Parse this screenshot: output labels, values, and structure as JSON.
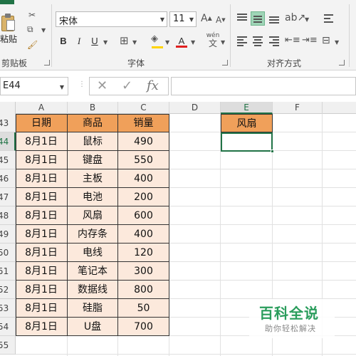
{
  "ribbon": {
    "clipboard": {
      "paste_label": "粘贴",
      "group_label": "剪贴板"
    },
    "font": {
      "font_name": "宋体",
      "font_size": "11",
      "group_label": "字体",
      "bold": "B",
      "italic": "I",
      "underline": "U",
      "grow_font": "A",
      "shrink_font": "A",
      "phonetic_top": "wén",
      "phonetic_bottom": "文",
      "font_color_letter": "A",
      "font_color": "#e02020",
      "fill_color": "#ffd400"
    },
    "alignment": {
      "group_label": "对齐方式"
    }
  },
  "formula_bar": {
    "name_box": "E44",
    "fx_label": "fx",
    "formula": ""
  },
  "grid": {
    "columns": [
      "A",
      "B",
      "C",
      "D",
      "E",
      "F"
    ],
    "active_column": "E",
    "rows": [
      "43",
      "44",
      "45",
      "46",
      "47",
      "48",
      "49",
      "50",
      "51",
      "52",
      "53",
      "54",
      "55"
    ],
    "active_row": "44",
    "headers": [
      "日期",
      "商品",
      "销量"
    ],
    "data": [
      [
        "8月1日",
        "鼠标",
        "490"
      ],
      [
        "8月1日",
        "键盘",
        "550"
      ],
      [
        "8月1日",
        "主板",
        "400"
      ],
      [
        "8月1日",
        "电池",
        "200"
      ],
      [
        "8月1日",
        "风扇",
        "600"
      ],
      [
        "8月1日",
        "内存条",
        "400"
      ],
      [
        "8月1日",
        "电线",
        "120"
      ],
      [
        "8月1日",
        "笔记本",
        "300"
      ],
      [
        "8月1日",
        "数据线",
        "800"
      ],
      [
        "8月1日",
        "硅脂",
        "50"
      ],
      [
        "8月1日",
        "U盘",
        "700"
      ]
    ],
    "criteria_header": "风扇",
    "selected_cell_value": ""
  },
  "colors": {
    "header_fill": "#f0a05a",
    "body_fill": "#fce9dc",
    "selection": "#217346"
  },
  "watermark": {
    "main": "百科全说",
    "sub": "助你轻松解决"
  }
}
